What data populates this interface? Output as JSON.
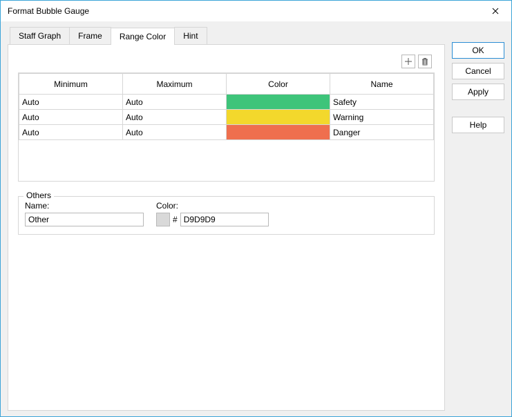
{
  "window": {
    "title": "Format Bubble Gauge"
  },
  "tabs": [
    {
      "label": "Staff Graph",
      "active": false
    },
    {
      "label": "Frame",
      "active": false
    },
    {
      "label": "Range Color",
      "active": true
    },
    {
      "label": "Hint",
      "active": false
    }
  ],
  "table": {
    "headers": {
      "minimum": "Minimum",
      "maximum": "Maximum",
      "color": "Color",
      "name": "Name"
    },
    "rows": [
      {
        "min": "Auto",
        "max": "Auto",
        "color": "#3ec47a",
        "name": "Safety"
      },
      {
        "min": "Auto",
        "max": "Auto",
        "color": "#f3d82c",
        "name": "Warning"
      },
      {
        "min": "Auto",
        "max": "Auto",
        "color": "#ef6f4e",
        "name": "Danger"
      }
    ]
  },
  "others": {
    "legend": "Others",
    "name_label": "Name:",
    "name_value": "Other",
    "color_label": "Color:",
    "hash": "#",
    "hex_value": "D9D9D9",
    "swatch_color": "#D9D9D9"
  },
  "buttons": {
    "ok": "OK",
    "cancel": "Cancel",
    "apply": "Apply",
    "help": "Help"
  }
}
